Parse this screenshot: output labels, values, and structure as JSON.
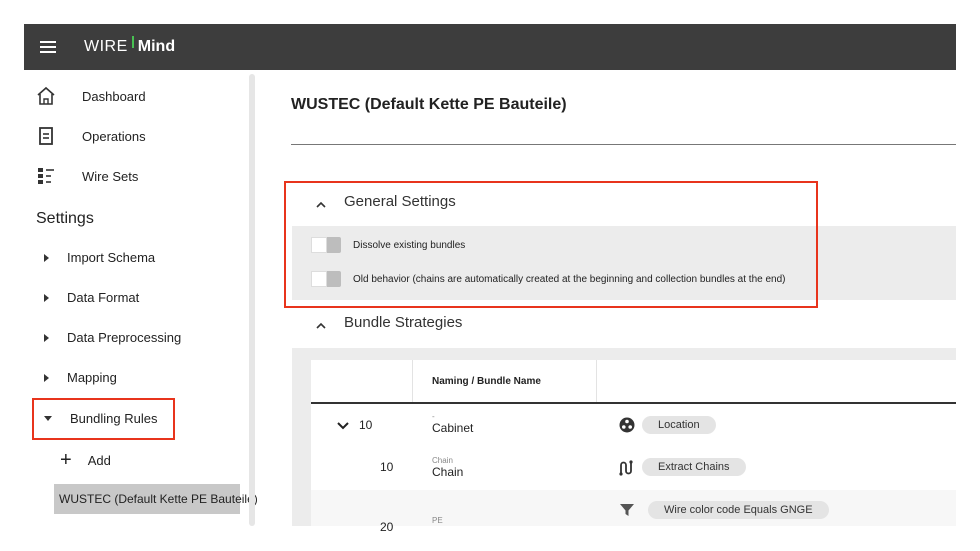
{
  "app": {
    "logo_wire": "WIRE",
    "logo_mind": "Mind",
    "accent_color": "#48c152",
    "topbar_color": "#3d3d3d"
  },
  "sidebar": {
    "nav": [
      {
        "label": "Dashboard",
        "icon": "home-icon"
      },
      {
        "label": "Operations",
        "icon": "document-icon"
      },
      {
        "label": "Wire Sets",
        "icon": "list-icon"
      }
    ],
    "settings_heading": "Settings",
    "settings_items": [
      {
        "label": "Import Schema",
        "expanded": false
      },
      {
        "label": "Data Format",
        "expanded": false
      },
      {
        "label": "Data Preprocessing",
        "expanded": false
      },
      {
        "label": "Mapping",
        "expanded": false
      },
      {
        "label": "Bundling Rules",
        "expanded": true
      }
    ],
    "add_label": "Add",
    "selected_rule": "WUSTEC (Default Kette PE Bauteile)"
  },
  "main": {
    "title": "WUSTEC (Default Kette PE Bauteile)",
    "general_settings": {
      "heading": "General Settings",
      "options": [
        {
          "label": "Dissolve existing bundles",
          "enabled": false
        },
        {
          "label": "Old behavior (chains are automatically created at the beginning and collection bundles at the end)",
          "enabled": false
        }
      ]
    },
    "bundle_strategies": {
      "heading": "Bundle Strategies",
      "columns": [
        "",
        "Naming / Bundle Name",
        ""
      ],
      "rows": [
        {
          "number": "10",
          "expandable": true,
          "name_small": "-",
          "name": "Cabinet",
          "icon": "location-icon",
          "chip": "Location"
        },
        {
          "number": "10",
          "expandable": false,
          "name_small": "Chain",
          "name": "Chain",
          "icon": "chain-icon",
          "chip": "Extract Chains"
        },
        {
          "number": "20",
          "expandable": false,
          "name_small": "PE",
          "name": "",
          "icon": "filter-icon",
          "chip": "Wire color code  Equals  GNGE"
        }
      ]
    }
  },
  "highlight_color": "#e8341c"
}
